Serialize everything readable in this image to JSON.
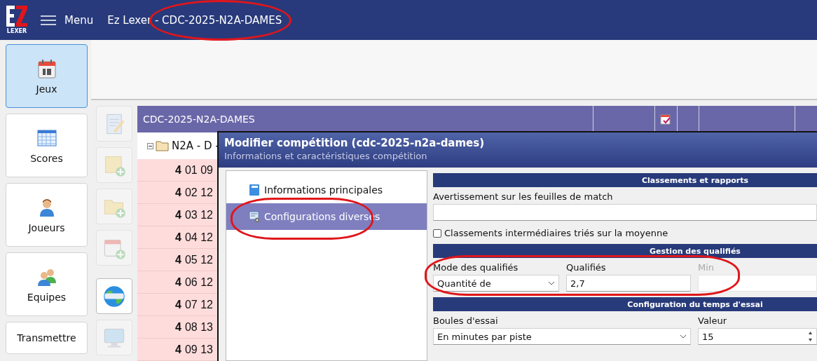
{
  "window": {
    "logo": "LEXER",
    "menu": "Menu",
    "title": "Ez Lexer - CDC-2025-N2A-DAMES",
    "circled": true
  },
  "nav": [
    {
      "label": "Jeux",
      "kind": "calendar",
      "selected": true
    },
    {
      "label": "Scores",
      "kind": "table",
      "selected": false
    },
    {
      "label": "Joueurs",
      "kind": "person",
      "selected": false
    },
    {
      "label": "Equipes",
      "kind": "people",
      "selected": false
    },
    {
      "label": "Transmettre",
      "kind": "none",
      "selected": false
    }
  ],
  "toolbar": [
    {
      "kind": "note",
      "disabled": true
    },
    {
      "kind": "note-add",
      "disabled": true
    },
    {
      "kind": "folder-add",
      "disabled": true
    },
    {
      "kind": "calendar-add",
      "disabled": true
    },
    {
      "kind": "globe",
      "disabled": false
    },
    {
      "kind": "monitor",
      "disabled": true
    }
  ],
  "grid": {
    "header": "CDC-2025-N2A-DAMES",
    "root": {
      "label": "N2A - D -",
      "expanded": true,
      "children": [
        {
          "round": "4",
          "label": "01 09"
        },
        {
          "round": "4",
          "label": "02 12"
        },
        {
          "round": "4",
          "label": "03 12"
        },
        {
          "round": "4",
          "label": "04 12"
        },
        {
          "round": "4",
          "label": "05 12"
        },
        {
          "round": "4",
          "label": "06 12"
        },
        {
          "round": "4",
          "label": "07 12"
        },
        {
          "round": "4",
          "label": "08 13"
        },
        {
          "round": "4",
          "label": "09 13"
        }
      ]
    }
  },
  "dialog": {
    "title": "Modifier compétition (cdc-2025-n2a-dames)",
    "subtitle": "Informations et caractéristiques compétition",
    "pages": [
      {
        "label": "Informations principales",
        "kind": "book",
        "selected": false,
        "circled": false
      },
      {
        "label": "Configurations diverses",
        "kind": "settings",
        "selected": true,
        "circled": true
      }
    ],
    "sections": [
      {
        "title": "Classements et rapports",
        "rows": [
          [
            {
              "kind": "text",
              "label": "Avertissement sur les feuilles de match"
            }
          ],
          [
            {
              "kind": "checkbox",
              "label": "Classements intermédiaires triés sur la moyenne",
              "checked": false
            }
          ]
        ]
      },
      {
        "title": "Gestion des qualifiés",
        "rows": [
          [
            {
              "kind": "select",
              "label": "Mode des qualifiés",
              "value": "Quantité de",
              "disabled": false,
              "circled": true
            },
            {
              "kind": "text",
              "label": "Qualifiés",
              "value": "2,7",
              "disabled": false,
              "circled": true
            },
            {
              "kind": "text",
              "label": "Min",
              "disabled": true,
              "circled": false
            }
          ]
        ]
      },
      {
        "title": "Configuration du temps d'essai",
        "rows": [
          [
            {
              "kind": "select",
              "label": "Boules d'essai",
              "value": "En minutes par piste"
            },
            {
              "kind": "spin",
              "label": "Valeur",
              "value": "15"
            }
          ]
        ]
      }
    ]
  }
}
